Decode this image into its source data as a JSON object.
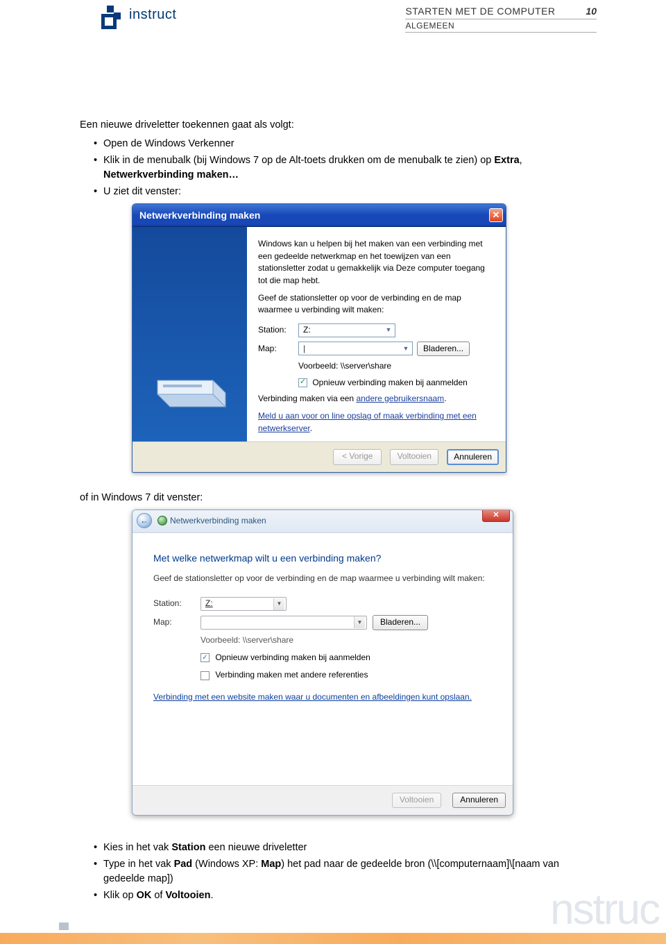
{
  "header": {
    "logo_text": "instruct",
    "title": "STARTEN MET DE COMPUTER",
    "page_number": "10",
    "subtitle": "ALGEMEEN"
  },
  "intro": "Een nieuwe driveletter toekennen gaat als volgt:",
  "bullets_top": {
    "b1": "Open de Windows Verkenner",
    "b2a": "Klik in de menubalk (bij Windows 7 op de Alt-toets drukken om de menubalk te zien) op ",
    "b2b": "Extra",
    "b2c": ", ",
    "b2d": "Netwerkverbinding maken…",
    "b3": "U ziet dit venster:"
  },
  "xp": {
    "title": "Netwerkverbinding maken",
    "desc1": "Windows kan u helpen bij het maken van een verbinding met een gedeelde netwerkmap en het toewijzen van een stationsletter zodat u gemakkelijk via Deze computer toegang tot die map hebt.",
    "desc2": "Geef de stationsletter op voor de verbinding en de map waarmee u verbinding wilt maken:",
    "drive_label": "Station:",
    "drive_value": "Z:",
    "map_label": "Map:",
    "map_value": "",
    "cursor": "|",
    "browse": "Bladeren...",
    "example": "Voorbeeld: \\\\server\\share",
    "reconnect": "Opnieuw verbinding maken bij aanmelden",
    "via_pre": "Verbinding maken via een ",
    "via_link": "andere gebruikersnaam",
    "via_post": ".",
    "signup1": "Meld u aan voor on line opslag of maak verbinding met een netwerkserver",
    "signup2": ".",
    "back": "< Vorige",
    "finish": "Voltooien",
    "cancel": "Annuleren"
  },
  "mid": "of in Windows 7 dit venster:",
  "w7": {
    "title": "Netwerkverbinding maken",
    "heading": "Met welke netwerkmap wilt u een verbinding maken?",
    "sub": "Geef de stationsletter op voor de verbinding en de map waarmee u verbinding wilt maken:",
    "drive_label": "Station:",
    "drive_value": "Z:",
    "map_label": "Map:",
    "browse": "Bladeren...",
    "example": "Voorbeeld: \\\\server\\share",
    "reconnect": "Opnieuw verbinding maken bij aanmelden",
    "other_creds": "Verbinding maken met andere referenties",
    "web_link": "Verbinding met een website maken waar u documenten en afbeeldingen kunt opslaan.",
    "finish": "Voltooien",
    "cancel": "Annuleren"
  },
  "bullets_bottom": {
    "b1a": "Kies in het vak ",
    "b1b": "Station",
    "b1c": " een nieuwe driveletter",
    "b2a": "Type in het vak ",
    "b2b": "Pad",
    "b2c": " (Windows XP: ",
    "b2d": "Map",
    "b2e": ") het pad naar de gedeelde bron (\\\\[computernaam]\\[naam van gedeelde map])",
    "b3a": "Klik op ",
    "b3b": "OK",
    "b3c": " of ",
    "b3d": "Voltooien",
    "b3e": "."
  }
}
